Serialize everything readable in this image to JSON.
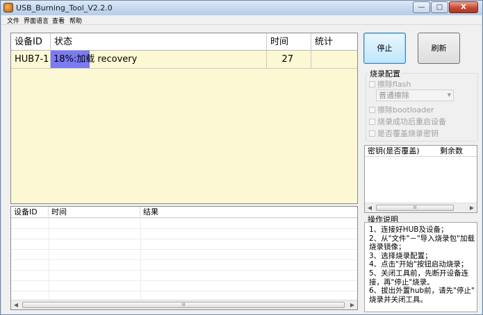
{
  "window": {
    "title": "USB_Burning_Tool_V2.2.0",
    "buttons": {
      "minimize": "—",
      "maximize": "□",
      "close": "X"
    }
  },
  "menu": [
    "文件",
    "界面语言",
    "查看",
    "帮助"
  ],
  "device_table": {
    "headers": [
      "设备ID",
      "状态",
      "时间",
      "统计"
    ],
    "rows": [
      {
        "device_id": "HUB7-1",
        "progress_pct": 18,
        "progress_text": "18%:加载",
        "status_text": "recovery",
        "time": "27",
        "stats": ""
      }
    ]
  },
  "log_table": {
    "headers": [
      "设备ID",
      "时间",
      "结果"
    ],
    "scroll_thumb": "III"
  },
  "buttons": {
    "stop": "停止",
    "refresh": "刷新"
  },
  "burn_config": {
    "title": "烧录配置",
    "erase_flash": "擦除flash",
    "erase_mode": "普通擦除",
    "erase_bootloader": "擦除bootloader",
    "reboot_after_success": "烧录成功后重启设备",
    "overwrite_key": "是否覆盖烧录密钥"
  },
  "key_table": {
    "headers": [
      "密钥(是否覆盖)",
      "剩余数"
    ],
    "scroll_thumb": "III"
  },
  "instructions": {
    "title": "操作说明",
    "lines": [
      "1、连接好HUB及设备；",
      "2、从\"文件\"－\"导入烧录包\"加载",
      "烧录镜像；",
      "3、选择烧录配置；",
      "4、点击\"开始\"按钮启动烧录；",
      "5、关闭工具前，先断开设备连",
      "接，再\"停止\"烧录。",
      "6、拔出外置hub前，请先\"停止\"",
      "烧录并关闭工具。"
    ]
  }
}
